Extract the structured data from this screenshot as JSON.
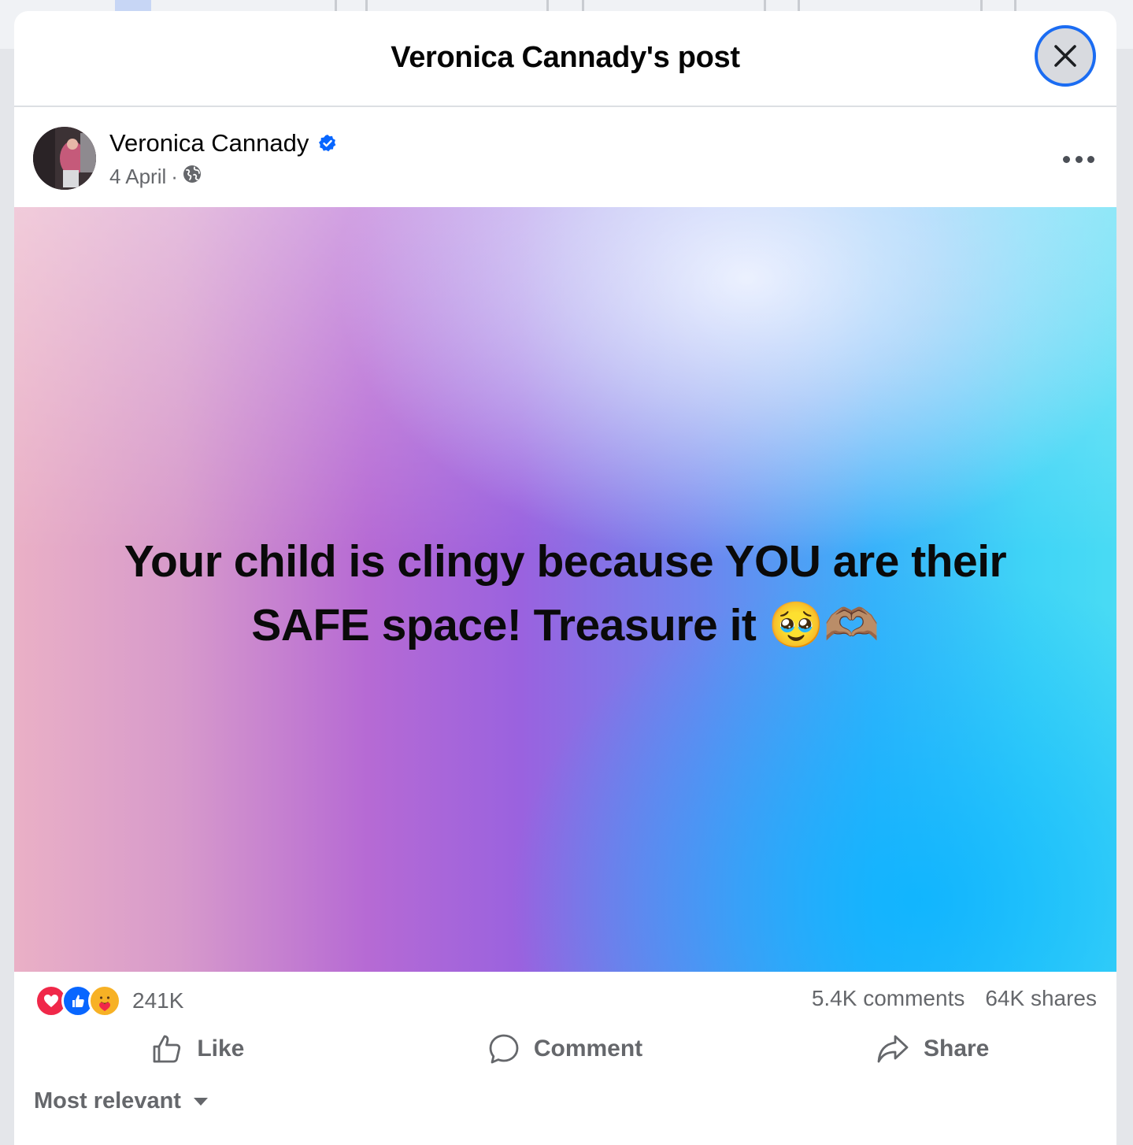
{
  "modal": {
    "title": "Veronica Cannady's post"
  },
  "post": {
    "author": "Veronica Cannady",
    "date": "4 April",
    "separator": "·",
    "audience_icon": "globe-icon",
    "verified_icon": "verified-badge-icon",
    "text": "Your child is clingy because YOU are their SAFE space! Treasure it 🥹🫶🏽"
  },
  "stats": {
    "reaction_icons": [
      "love-reaction-icon",
      "like-reaction-icon",
      "care-reaction-icon"
    ],
    "reaction_count": "241K",
    "comments": "5.4K comments",
    "shares": "64K shares"
  },
  "actions": {
    "like": "Like",
    "comment": "Comment",
    "share": "Share"
  },
  "comments_sort": {
    "label": "Most relevant"
  },
  "colors": {
    "accent": "#1b6cf2",
    "verified": "#0866ff",
    "secondary_text": "#65676b",
    "love": "#f02849",
    "like": "#0866ff"
  }
}
